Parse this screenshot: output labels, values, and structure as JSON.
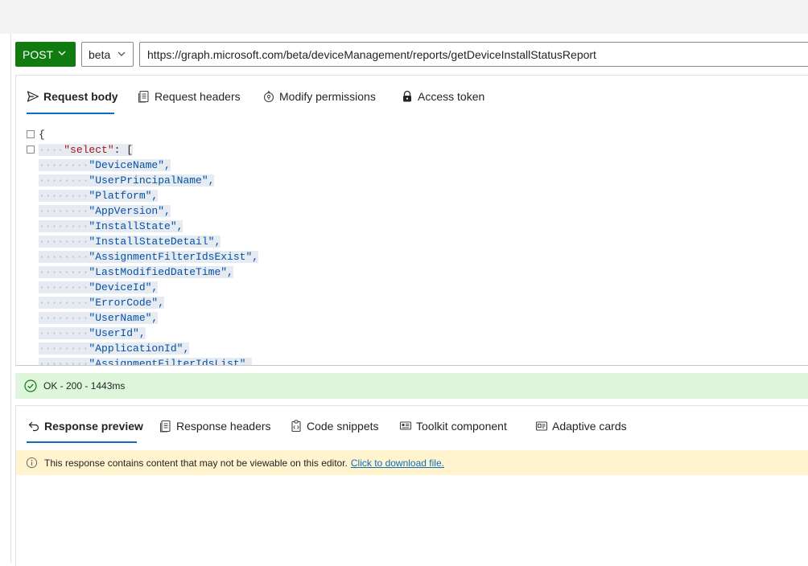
{
  "request": {
    "method": "POST",
    "version": "beta",
    "url": "https://graph.microsoft.com/beta/deviceManagement/reports/getDeviceInstallStatusReport"
  },
  "request_tabs": [
    {
      "label": "Request body",
      "icon": "send-icon",
      "active": true
    },
    {
      "label": "Request headers",
      "icon": "document-icon",
      "active": false
    },
    {
      "label": "Modify permissions",
      "icon": "shield-key-icon",
      "active": false
    },
    {
      "label": "Access token",
      "icon": "lock-icon",
      "active": false
    }
  ],
  "request_body": {
    "open_brace": "{",
    "select_key": "\"select\"",
    "select_rest": ": [",
    "fields": [
      "\"DeviceName\",",
      "\"UserPrincipalName\",",
      "\"Platform\",",
      "\"AppVersion\",",
      "\"InstallState\",",
      "\"InstallStateDetail\",",
      "\"AssignmentFilterIdsExist\",",
      "\"LastModifiedDateTime\",",
      "\"DeviceId\",",
      "\"ErrorCode\",",
      "\"UserName\",",
      "\"UserId\",",
      "\"ApplicationId\",",
      "\"AssignmentFilterIdsList\","
    ]
  },
  "status": {
    "text": "OK - 200 - 1443ms",
    "color": "#dff6dd"
  },
  "response_tabs": [
    {
      "label": "Response preview",
      "icon": "undo-arrow-icon",
      "active": true
    },
    {
      "label": "Response headers",
      "icon": "document-icon",
      "active": false
    },
    {
      "label": "Code snippets",
      "icon": "clipboard-code-icon",
      "active": false
    },
    {
      "label": "Toolkit component",
      "icon": "toolkit-icon",
      "active": false
    },
    {
      "label": "Adaptive cards",
      "icon": "card-icon",
      "active": false
    }
  ],
  "notice": {
    "text": "This response contains content that may not be viewable on this editor.",
    "link": "Click to download file."
  }
}
